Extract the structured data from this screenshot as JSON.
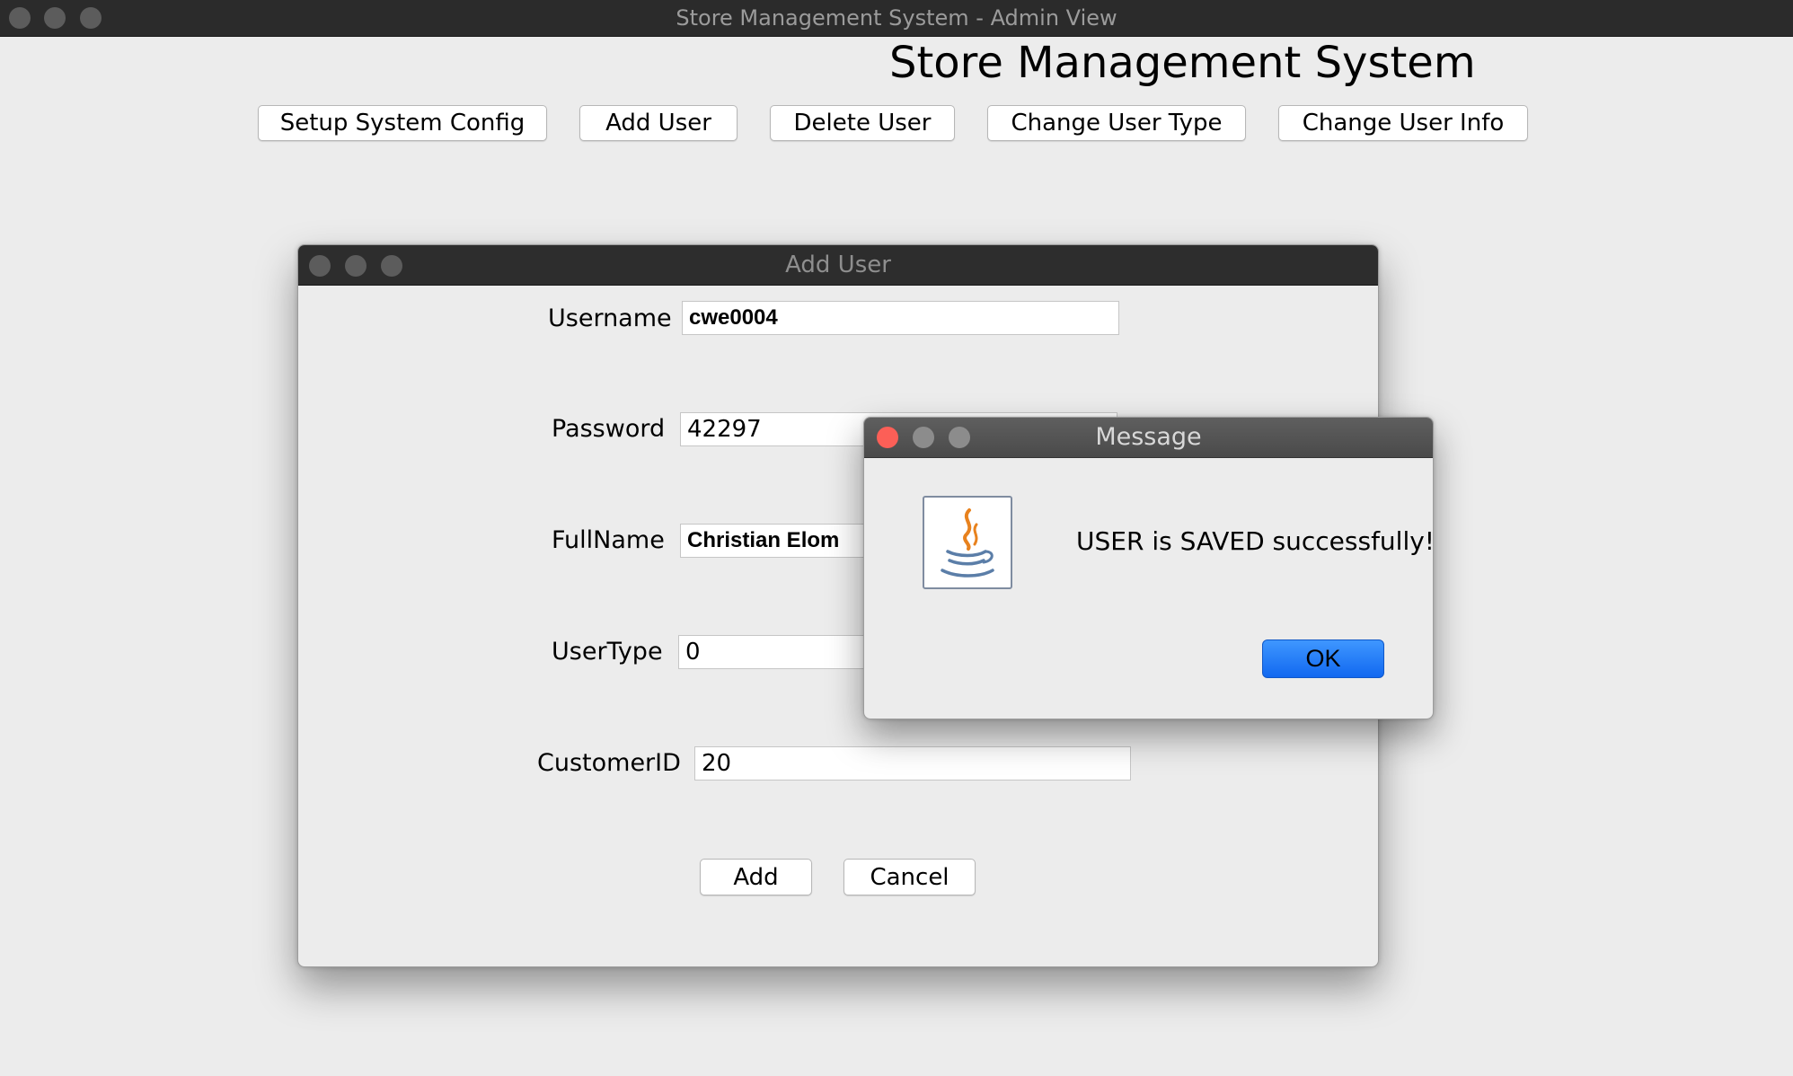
{
  "window": {
    "title": "Store Management System - Admin View"
  },
  "header": {
    "heading": "Store Management System"
  },
  "toolbar": {
    "setup_label": "Setup System Config",
    "add_user_label": "Add User",
    "delete_user_label": "Delete User",
    "change_type_label": "Change User Type",
    "change_info_label": "Change User Info"
  },
  "add_dialog": {
    "title": "Add User",
    "fields": {
      "username": {
        "label": "Username",
        "value": "cwe0004"
      },
      "password": {
        "label": "Password",
        "value": "42297"
      },
      "fullname": {
        "label": "FullName",
        "value": "Christian Elom"
      },
      "usertype": {
        "label": "UserType",
        "value": "0"
      },
      "customerid": {
        "label": "CustomerID",
        "value": "20"
      }
    },
    "add_label": "Add",
    "cancel_label": "Cancel"
  },
  "message_dialog": {
    "title": "Message",
    "text": "USER is SAVED successfully!",
    "ok_label": "OK",
    "icon": "java-coffee-cup-icon"
  },
  "colors": {
    "titlebar": "#2b2b2b",
    "background": "#ececec",
    "ok_button": "#1a73f5",
    "close_button": "#fc5f57"
  }
}
